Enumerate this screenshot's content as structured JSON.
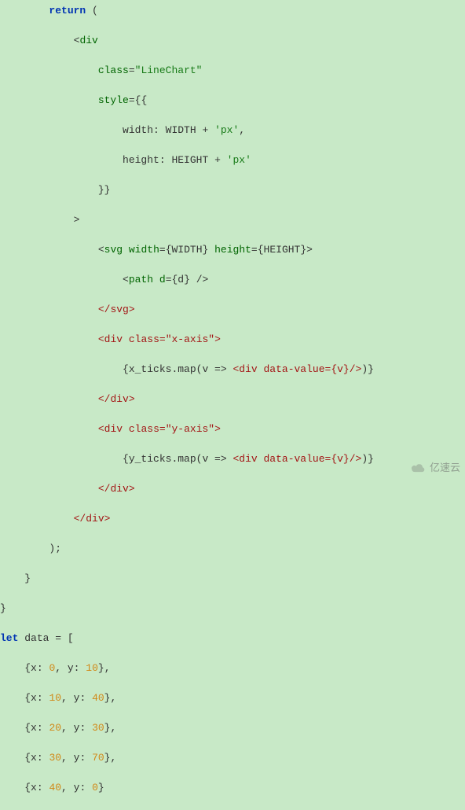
{
  "code": {
    "kw_return": "return",
    "kw_let": "let",
    "open_paren": " (",
    "tag_div_open": "div",
    "attr_class": "class",
    "class_val": "\"LineChart\"",
    "attr_style": "style",
    "eq": "=",
    "style_open": "{{",
    "style_close": "}}",
    "style_width_key": "width",
    "style_width_expr": "WIDTH",
    "plus": " + ",
    "px": "'px'",
    "comma": ",",
    "style_height_key": "height",
    "style_height_expr": "HEIGHT",
    "gt": ">",
    "lt": "<",
    "slash": "/",
    "tag_svg": "svg",
    "attr_width": "width",
    "val_width": "{WIDTH}",
    "attr_height": "height",
    "val_height": "{HEIGHT}",
    "tag_path": "path",
    "attr_d": "d",
    "val_d": "{d}",
    "close_svg": "svg",
    "div_close": "div",
    "xaxis_open": "div",
    "xaxis_attr": "class",
    "xaxis_val": "\"x-axis\"",
    "xticks_expr": "{x_ticks.map(v => ",
    "ticks_el_open": "div",
    "ticks_attr": "data-value",
    "ticks_val": "{v}",
    "ticks_tail": ")}",
    "close_div": "div",
    "yaxis_open": "div",
    "yaxis_attr": "class",
    "yaxis_val": "\"y-axis\"",
    "yticks_expr": "{y_ticks.map(v => ",
    "close_outer_div": "div",
    "close_paren": ");",
    "rbrace": "}",
    "data_name": "data",
    "data_open": " = [",
    "rows": [
      {
        "x": "0",
        "y": "10"
      },
      {
        "x": "10",
        "y": "40"
      },
      {
        "x": "20",
        "y": "30"
      },
      {
        "x": "30",
        "y": "70"
      },
      {
        "x": "40",
        "y": "0"
      }
    ],
    "row_open": "{x: ",
    "row_mid": ", y: ",
    "row_close": "}"
  },
  "watermark": {
    "text": "亿速云"
  }
}
